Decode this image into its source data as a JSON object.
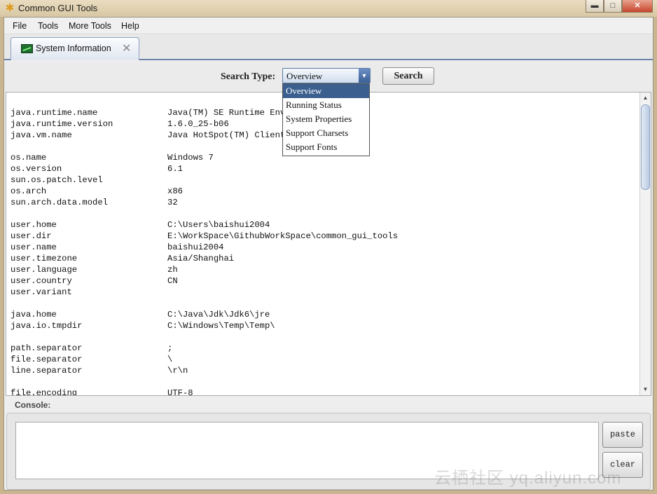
{
  "window": {
    "title": "Common GUI Tools",
    "icon": "gear-icon",
    "minimize": "▬",
    "maximize": "□",
    "close": "✕"
  },
  "menu": [
    "File",
    "Tools",
    "More Tools",
    "Help"
  ],
  "tab": {
    "label": "System Information",
    "icon": "monitor-icon",
    "close": "✕"
  },
  "search": {
    "label": "Search Type:",
    "selected": "Overview",
    "options": [
      "Overview",
      "Running Status",
      "System Properties",
      "Support Charsets",
      "Support Fonts"
    ],
    "button": "Search"
  },
  "info": [
    [
      "java.runtime.name",
      "Java(TM) SE Runtime Envi"
    ],
    [
      "java.runtime.version",
      "1.6.0_25-b06"
    ],
    [
      "java.vm.name",
      "Java HotSpot(TM) Client"
    ],
    [
      "",
      ""
    ],
    [
      "os.name",
      "Windows 7"
    ],
    [
      "os.version",
      "6.1"
    ],
    [
      "sun.os.patch.level",
      ""
    ],
    [
      "os.arch",
      "x86"
    ],
    [
      "sun.arch.data.model",
      "32"
    ],
    [
      "",
      ""
    ],
    [
      "user.home",
      "C:\\Users\\baishui2004"
    ],
    [
      "user.dir",
      "E:\\WorkSpace\\GithubWorkSpace\\common_gui_tools"
    ],
    [
      "user.name",
      "baishui2004"
    ],
    [
      "user.timezone",
      "Asia/Shanghai"
    ],
    [
      "user.language",
      "zh"
    ],
    [
      "user.country",
      "CN"
    ],
    [
      "user.variant",
      ""
    ],
    [
      "",
      ""
    ],
    [
      "java.home",
      "C:\\Java\\Jdk\\Jdk6\\jre"
    ],
    [
      "java.io.tmpdir",
      "C:\\Windows\\Temp\\Temp\\"
    ],
    [
      "",
      ""
    ],
    [
      "path.separator",
      ";"
    ],
    [
      "file.separator",
      "\\"
    ],
    [
      "line.separator",
      "\\r\\n"
    ],
    [
      "",
      ""
    ],
    [
      "file.encoding",
      "UTF-8"
    ]
  ],
  "console": {
    "label": "Console:",
    "paste": "paste",
    "clear": "clear"
  },
  "watermark": "云栖社区 yq.aliyun.com"
}
